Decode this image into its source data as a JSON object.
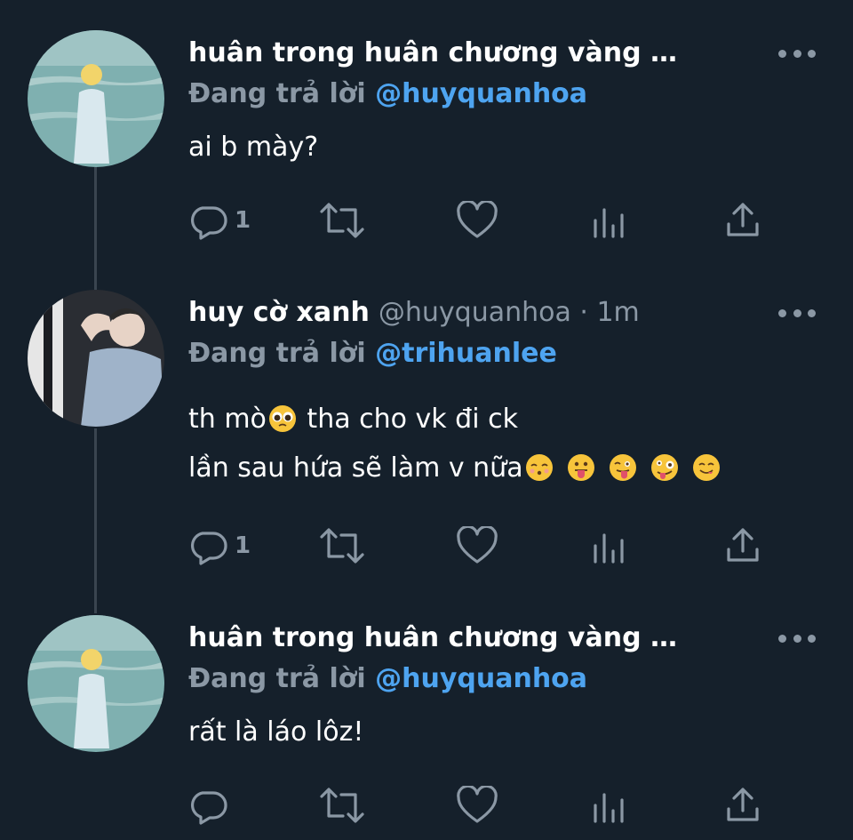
{
  "tweets": [
    {
      "display_name": "huân trong huân chương vàng …",
      "handle": "",
      "reply_prefix": "Đang trả lời",
      "reply_to": "@huyquanhoa",
      "body": [
        "ai b mày?"
      ],
      "reply_count": "1"
    },
    {
      "display_name": "huy cờ xanh",
      "handle": "@huyquanhoa · 1m",
      "reply_prefix": "Đang trả lời",
      "reply_to": "@trihuanlee",
      "body_line1_text_a": "th mò",
      "body_line1_text_b": " tha cho vk đi ck",
      "body_line2_text": "lần sau hứa sẽ làm v nữa",
      "emojis_line1": [
        "pleading-face"
      ],
      "emojis_line2": [
        "kissing-closed-eyes-face",
        "tongue-out-face",
        "winking-tongue-face",
        "zany-face",
        "yum-face"
      ],
      "reply_count": "1"
    },
    {
      "display_name": "huân trong huân chương vàng …",
      "handle": "",
      "reply_prefix": "Đang trả lời",
      "reply_to": "@huyquanhoa",
      "body": [
        "rất là láo lôz!"
      ],
      "reply_count": ""
    }
  ],
  "icons": [
    "reply-icon",
    "retweet-icon",
    "like-icon",
    "analytics-icon",
    "share-icon",
    "more-icon"
  ],
  "colors": {
    "background": "#15202b",
    "text": "#ffffff",
    "secondary": "#8b98a5",
    "mention": "#4ea4f0",
    "thread_line": "#3a4550"
  }
}
